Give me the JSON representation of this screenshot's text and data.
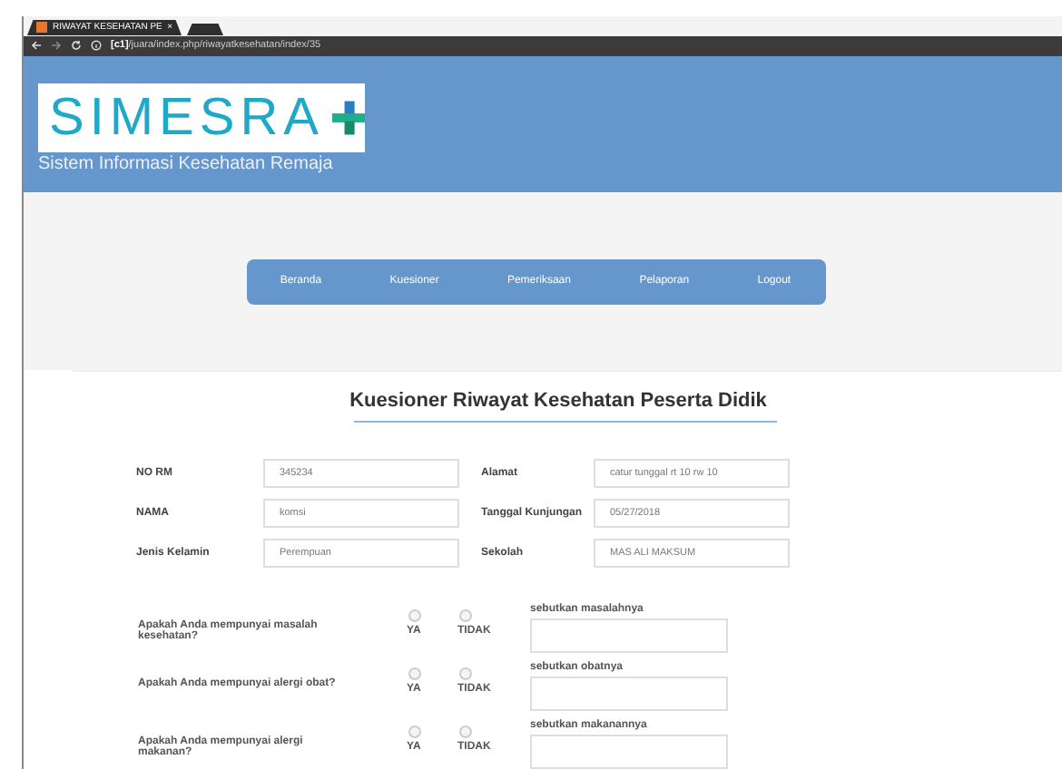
{
  "browser": {
    "tab_title": "RIWAYAT KESEHATAN PE",
    "tab_close": "×",
    "url_host": "[c1]",
    "url_path": "/juara/index.php/riwayatkesehatan/index/35"
  },
  "header": {
    "logo": "SIMESRA",
    "subtitle": "Sistem Informasi Kesehatan Remaja"
  },
  "nav": [
    "Beranda",
    "Kuesioner",
    "Pemeriksaan",
    "Pelaporan",
    "Logout"
  ],
  "title": "Kuesioner Riwayat Kesehatan Peserta Didik",
  "fields": [
    {
      "label": "NO RM",
      "value": "345234"
    },
    {
      "label": "Alamat",
      "value": "catur tunggal rt 10 rw 10"
    },
    {
      "label": "NAMA",
      "value": "komsi"
    },
    {
      "label": "Tanggal Kunjungan",
      "value": "05/27/2018"
    },
    {
      "label": "Jenis Kelamin",
      "value": "Perempuan"
    },
    {
      "label": "Sekolah",
      "value": "MAS ALI MAKSUM"
    }
  ],
  "questions": [
    {
      "text": "Apakah Anda mempunyai masalah kesehatan?",
      "options": [
        {
          "label": "YA",
          "selected": false
        },
        {
          "label": "TIDAK",
          "selected": false
        }
      ],
      "detail_label": "sebutkan masalahnya"
    },
    {
      "text": "Apakah Anda mempunyai alergi obat?",
      "options": [
        {
          "label": "YA",
          "selected": false
        },
        {
          "label": "TIDAK",
          "selected": false
        }
      ],
      "detail_label": "sebutkan obatnya"
    },
    {
      "text": "Apakah Anda mempunyai alergi makanan?",
      "options": [
        {
          "label": "YA",
          "selected": false
        },
        {
          "label": "TIDAK",
          "selected": false
        }
      ],
      "detail_label": "sebutkan makanannya"
    }
  ]
}
